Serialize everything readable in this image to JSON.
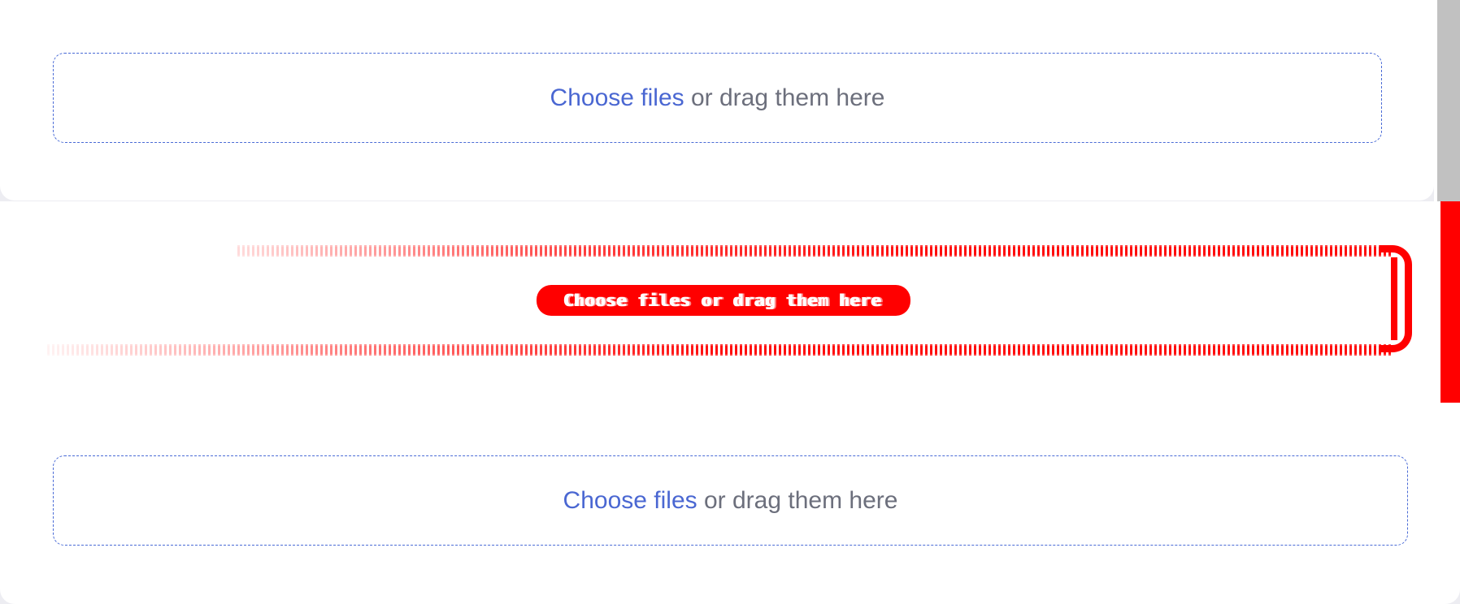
{
  "upload_top": {
    "link": "Choose files",
    "text": "or drag them here"
  },
  "upload_glitched": {
    "text": "Choose files or drag them here"
  },
  "upload_bottom": {
    "link": "Choose files",
    "text": "or drag them here"
  },
  "colors": {
    "accent": "#4a67d2",
    "muted_text": "#6c6f7c",
    "dashed_border": "#4a6bd6",
    "glitch_red": "#ff0000",
    "scrollbar_thumb": "#c1c1c1"
  }
}
